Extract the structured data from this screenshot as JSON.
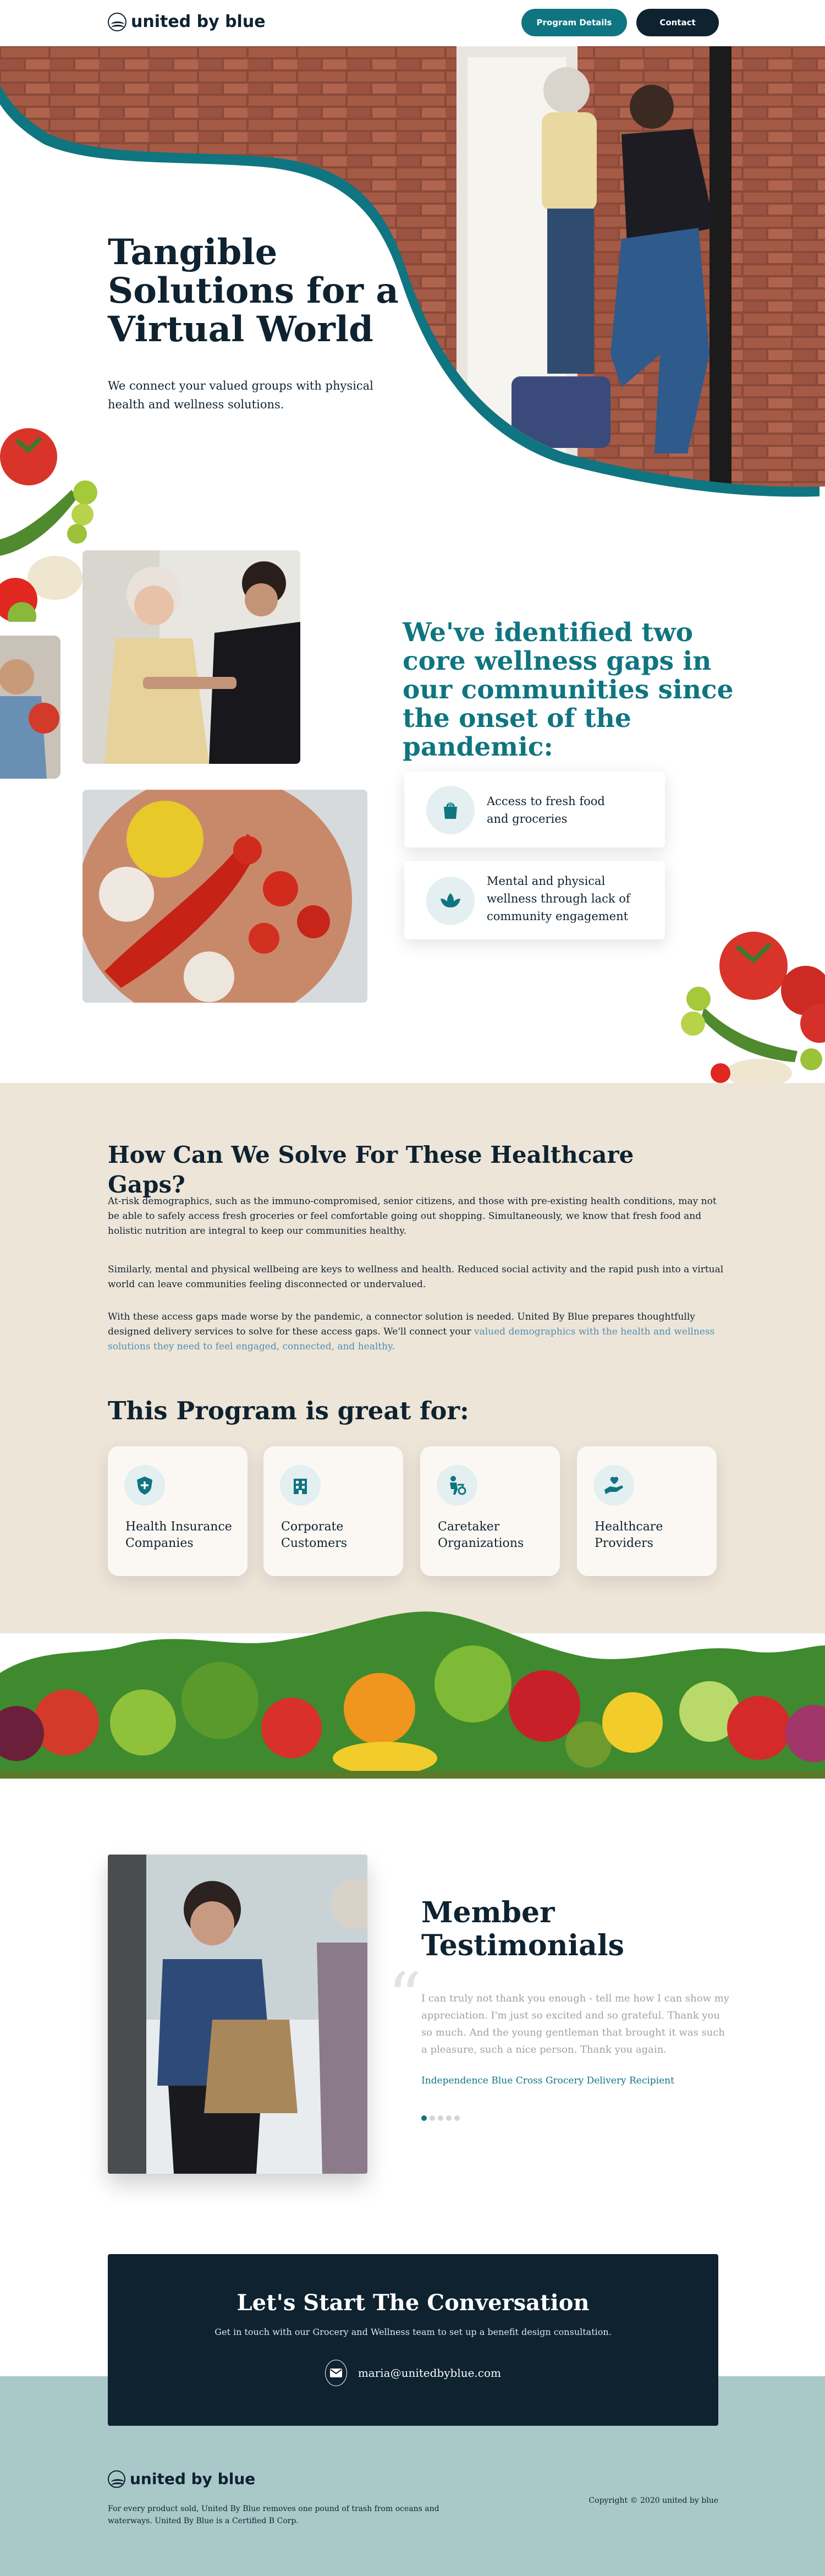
{
  "header": {
    "brand": "united by blue",
    "program_details_label": "Program Details",
    "contact_label": "Contact"
  },
  "hero": {
    "title": "Tangible Solutions for a Virtual World",
    "subtitle": "We connect your valued groups with physical health and wellness solutions."
  },
  "gaps": {
    "heading": "We've identified two core wellness gaps in our communities since the onset of the pandemic:",
    "items": [
      {
        "label": "Access to fresh food and groceries",
        "icon": "grocery-bag-icon"
      },
      {
        "label": "Mental and physical wellness through lack of community engagement",
        "icon": "lotus-icon"
      }
    ]
  },
  "solve": {
    "heading": "How Can We Solve For These Healthcare Gaps?",
    "p1": "At-risk demographics, such as the immuno-compromised, senior citizens, and those with pre-existing health conditions, may not be able to safely access fresh groceries or feel comfortable going out shopping. Simultaneously, we know that fresh food and holistic nutrition are integral to keep our communities healthy.",
    "p2": "Similarly, mental and physical wellbeing are keys to wellness and health. Reduced social activity and the rapid push into a virtual world can leave communities feeling disconnected or undervalued.",
    "p3_text": "With these access gaps made worse by the pandemic, a connector solution is needed. United By Blue prepares thoughtfully designed delivery services to solve for these access gaps. We'll connect your ",
    "p3_link": "valued demographics with the health and wellness solutions they need to feel engaged, connected, and healthy."
  },
  "program": {
    "heading": "This Program is great for:",
    "cards": [
      {
        "label": "Health Insurance Companies",
        "icon": "shield-plus-icon"
      },
      {
        "label": "Corporate Customers",
        "icon": "building-icon"
      },
      {
        "label": "Caretaker Organizations",
        "icon": "caretaker-icon"
      },
      {
        "label": "Healthcare Providers",
        "icon": "hand-heart-icon"
      }
    ]
  },
  "testimonials": {
    "heading": "Member Testimonials",
    "quote": "I can truly not thank you enough - tell me how I can show my appreciation. I'm just so excited and so grateful. Thank you so much. And the young gentleman that brought it was such a pleasure, such a nice person. Thank you again.",
    "attribution": "Independence Blue Cross Grocery Delivery Recipient",
    "slides": 5,
    "active_slide": 1
  },
  "cta": {
    "heading": "Let's Start The Conversation",
    "subtext": "Get in touch with our Grocery and Wellness team to set up a benefit design consultation.",
    "email": "maria@unitedbyblue.com"
  },
  "footer": {
    "brand": "united by blue",
    "blurb": "For every product sold, United By Blue removes one pound of trash from oceans and waterways. United By Blue is a Certified B Corp.",
    "copyright": "Copyright © 2020  united by blue"
  },
  "colors": {
    "navy": "#0e2230",
    "teal": "#0f7580",
    "beige": "#ede5d8",
    "footer_bg": "#a9c8c8",
    "link_blue": "#4f8fb5"
  }
}
